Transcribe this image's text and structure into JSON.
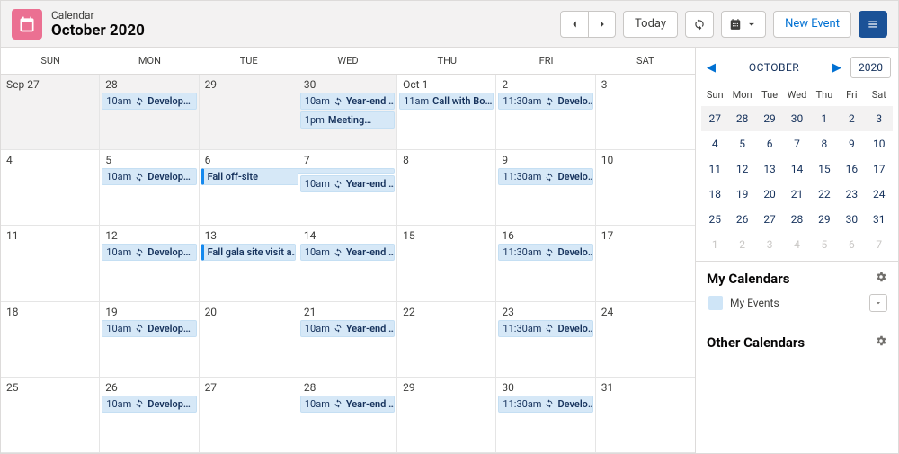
{
  "header": {
    "subtitle": "Calendar",
    "title": "October 2020",
    "today_label": "Today",
    "new_event_label": "New Event"
  },
  "calendar": {
    "dow": [
      "SUN",
      "MON",
      "TUE",
      "WED",
      "THU",
      "FRI",
      "SAT"
    ],
    "weeks": [
      [
        {
          "num": "Sep 27",
          "prev": true,
          "events": []
        },
        {
          "num": "28",
          "prev": true,
          "events": [
            {
              "time": "10am",
              "recurring": true,
              "title": "Develop…"
            }
          ]
        },
        {
          "num": "29",
          "prev": true,
          "events": []
        },
        {
          "num": "30",
          "prev": true,
          "events": [
            {
              "time": "10am",
              "recurring": true,
              "title": "Year-end …"
            },
            {
              "time": "1pm",
              "recurring": false,
              "title": "Meeting…"
            }
          ]
        },
        {
          "num": "Oct 1",
          "events": [
            {
              "time": "11am",
              "recurring": false,
              "title": "Call with Bo…"
            }
          ]
        },
        {
          "num": "2",
          "events": [
            {
              "time": "11:30am",
              "recurring": true,
              "title": "Develo…"
            }
          ]
        },
        {
          "num": "3",
          "events": []
        }
      ],
      [
        {
          "num": "4",
          "events": []
        },
        {
          "num": "5",
          "events": [
            {
              "time": "10am",
              "recurring": true,
              "title": "Develop…"
            }
          ]
        },
        {
          "num": "6",
          "events": [
            {
              "allday": true,
              "span": "start",
              "title": "Fall off-site"
            }
          ]
        },
        {
          "num": "7",
          "events": [
            {
              "allday": true,
              "span": "end",
              "title": ""
            },
            {
              "time": "10am",
              "recurring": true,
              "title": "Year-end …"
            }
          ]
        },
        {
          "num": "8",
          "events": []
        },
        {
          "num": "9",
          "events": [
            {
              "time": "11:30am",
              "recurring": true,
              "title": "Develo…"
            }
          ]
        },
        {
          "num": "10",
          "events": []
        }
      ],
      [
        {
          "num": "11",
          "events": []
        },
        {
          "num": "12",
          "events": [
            {
              "time": "10am",
              "recurring": true,
              "title": "Develop…"
            }
          ]
        },
        {
          "num": "13",
          "events": [
            {
              "allday": true,
              "title": "Fall gala site visit a…"
            }
          ]
        },
        {
          "num": "14",
          "events": [
            {
              "time": "10am",
              "recurring": true,
              "title": "Year-end …"
            }
          ]
        },
        {
          "num": "15",
          "events": []
        },
        {
          "num": "16",
          "events": [
            {
              "time": "11:30am",
              "recurring": true,
              "title": "Develo…"
            }
          ]
        },
        {
          "num": "17",
          "events": []
        }
      ],
      [
        {
          "num": "18",
          "events": []
        },
        {
          "num": "19",
          "events": [
            {
              "time": "10am",
              "recurring": true,
              "title": "Develop…"
            }
          ]
        },
        {
          "num": "20",
          "events": []
        },
        {
          "num": "21",
          "events": [
            {
              "time": "10am",
              "recurring": true,
              "title": "Year-end …"
            }
          ]
        },
        {
          "num": "22",
          "events": []
        },
        {
          "num": "23",
          "events": [
            {
              "time": "11:30am",
              "recurring": true,
              "title": "Develo…"
            }
          ]
        },
        {
          "num": "24",
          "events": []
        }
      ],
      [
        {
          "num": "25",
          "events": []
        },
        {
          "num": "26",
          "events": [
            {
              "time": "10am",
              "recurring": true,
              "title": "Develop…"
            }
          ]
        },
        {
          "num": "27",
          "events": []
        },
        {
          "num": "28",
          "events": [
            {
              "time": "10am",
              "recurring": true,
              "title": "Year-end …"
            }
          ]
        },
        {
          "num": "29",
          "events": []
        },
        {
          "num": "30",
          "events": [
            {
              "time": "11:30am",
              "recurring": true,
              "title": "Develo…"
            }
          ]
        },
        {
          "num": "31",
          "events": []
        }
      ]
    ]
  },
  "mini": {
    "month_label": "OCTOBER",
    "year": "2020",
    "dow": [
      "Sun",
      "Mon",
      "Tue",
      "Wed",
      "Thu",
      "Fri",
      "Sat"
    ],
    "rows": [
      [
        {
          "n": "27",
          "o": false
        },
        {
          "n": "28",
          "o": false
        },
        {
          "n": "29",
          "o": false
        },
        {
          "n": "30",
          "o": false
        },
        {
          "n": "1",
          "o": false
        },
        {
          "n": "2",
          "o": false
        },
        {
          "n": "3",
          "o": false
        }
      ],
      [
        {
          "n": "4",
          "o": false
        },
        {
          "n": "5",
          "o": false
        },
        {
          "n": "6",
          "o": false
        },
        {
          "n": "7",
          "o": false
        },
        {
          "n": "8",
          "o": false
        },
        {
          "n": "9",
          "o": false
        },
        {
          "n": "10",
          "o": false
        }
      ],
      [
        {
          "n": "11",
          "o": false
        },
        {
          "n": "12",
          "o": false
        },
        {
          "n": "13",
          "o": false
        },
        {
          "n": "14",
          "o": false
        },
        {
          "n": "15",
          "o": false
        },
        {
          "n": "16",
          "o": false
        },
        {
          "n": "17",
          "o": false
        }
      ],
      [
        {
          "n": "18",
          "o": false
        },
        {
          "n": "19",
          "o": false
        },
        {
          "n": "20",
          "o": false
        },
        {
          "n": "21",
          "o": false
        },
        {
          "n": "22",
          "o": false
        },
        {
          "n": "23",
          "o": false
        },
        {
          "n": "24",
          "o": false
        }
      ],
      [
        {
          "n": "25",
          "o": false
        },
        {
          "n": "26",
          "o": false
        },
        {
          "n": "27",
          "o": false
        },
        {
          "n": "28",
          "o": false
        },
        {
          "n": "29",
          "o": false
        },
        {
          "n": "30",
          "o": false
        },
        {
          "n": "31",
          "o": false
        }
      ],
      [
        {
          "n": "1",
          "o": true
        },
        {
          "n": "2",
          "o": true
        },
        {
          "n": "3",
          "o": true
        },
        {
          "n": "4",
          "o": true
        },
        {
          "n": "5",
          "o": true
        },
        {
          "n": "6",
          "o": true
        },
        {
          "n": "7",
          "o": true
        }
      ]
    ]
  },
  "sidebar": {
    "my_calendars_title": "My Calendars",
    "other_calendars_title": "Other Calendars",
    "items": [
      {
        "label": "My Events",
        "color": "#cfe5f7"
      }
    ]
  }
}
